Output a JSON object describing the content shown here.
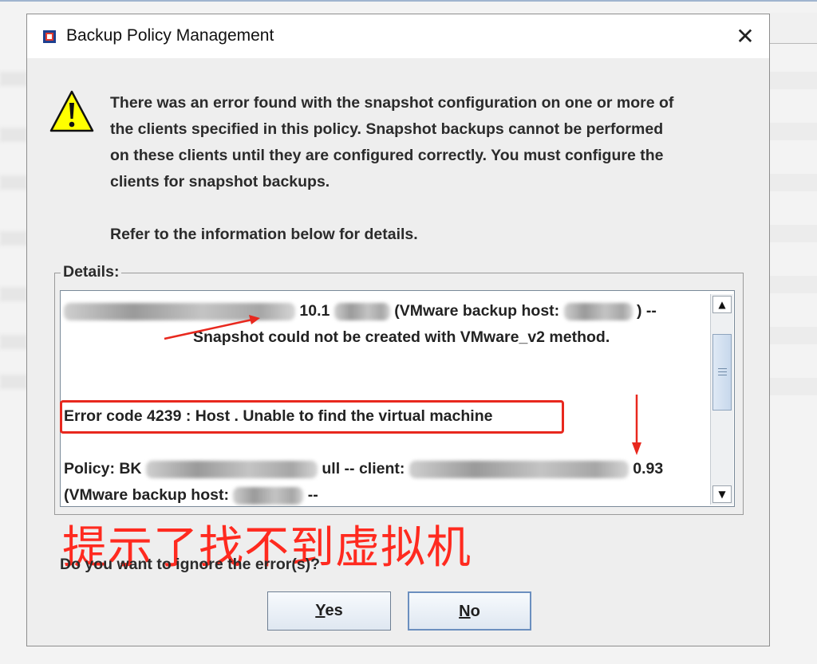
{
  "window": {
    "title": "Backup Policy Management",
    "close_symbol": "✕"
  },
  "message": {
    "lines": [
      "There was an error found with the snapshot configuration on one or more of",
      "the clients specified in this policy. Snapshot backups cannot be performed",
      "on these clients until they are configured correctly. You must configure the",
      "clients for snapshot backups."
    ],
    "refer": "Refer to the information below for details."
  },
  "details": {
    "legend": "Details:",
    "line1_a": "10.1",
    "line1_b": "(VMware backup host:",
    "line1_c": ") --",
    "line2": "Snapshot could not be created with VMware_v2 method.",
    "error_line": "Error code 4239 : Host . Unable to find the virtual machine",
    "policy_a": "Policy: BK",
    "policy_b": "ull -- client:",
    "policy_c": "0.93",
    "host_a": "(VMware backup host:",
    "host_b": "--"
  },
  "annotation": {
    "text": "提示了找不到虚拟机",
    "color": "#ff2a1f"
  },
  "question": "Do you want to ignore the error(s)?",
  "buttons": {
    "yes_mnemonic": "Y",
    "yes_rest": "es",
    "no_mnemonic": "N",
    "no_rest": "o"
  },
  "icons": {
    "warning": "warning-triangle-icon",
    "app": "app-icon",
    "scroll_up": "▲",
    "scroll_down": "▼"
  },
  "colors": {
    "highlight": "#e8281e",
    "warning_fill": "#ffff00"
  }
}
